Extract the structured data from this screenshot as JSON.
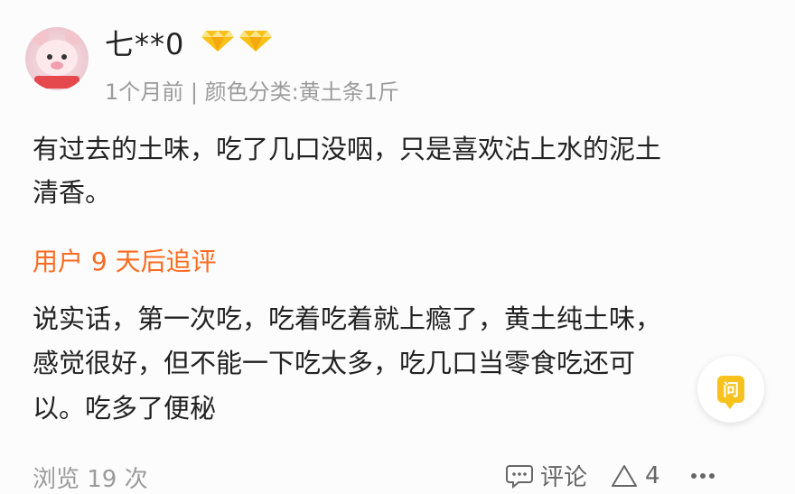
{
  "comment": {
    "username": "七**0",
    "badges": [
      "diamond-icon",
      "diamond-icon"
    ],
    "time": "1个月前",
    "separator": "|",
    "spec": "颜色分类:黄土条1斤",
    "content_line1": "有过去的土味，吃了几口没咽，只是喜欢沾上水的泥土",
    "content_line2": "清香。",
    "followup_label": "用户 9 天后追评",
    "followup_line1": "说实话，第一次吃，吃着吃着就上瘾了，黄土纯土味，",
    "followup_line2": "感觉很好，但不能一下吃太多，吃几口当零食吃还可",
    "followup_line3": "以。吃多了便秘"
  },
  "ask_button": {
    "label": "问"
  },
  "footer": {
    "views": "浏览 19 次",
    "comment_label": "评论",
    "like_count": "4"
  },
  "colors": {
    "accent": "#ff6a1f",
    "muted": "#9b9b9b",
    "ask": "#f7c21d"
  }
}
